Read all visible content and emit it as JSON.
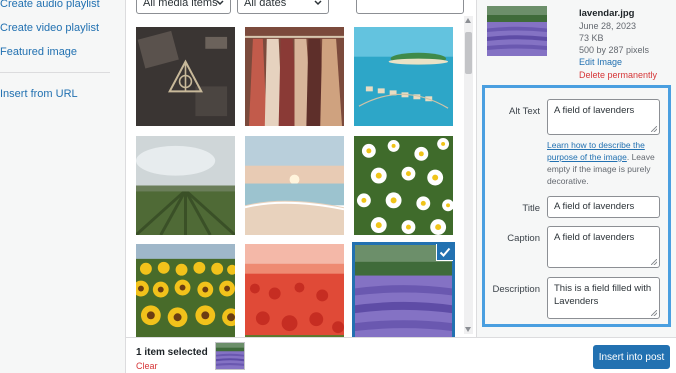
{
  "left_menu": {
    "items": [
      "Create audio playlist",
      "Create video playlist",
      "Featured image",
      "Insert from URL"
    ]
  },
  "toolbar": {
    "media_filter": "All media items",
    "date_filter": "All dates",
    "search_placeholder": ""
  },
  "grid": {
    "items": [
      {
        "icon": "dark-flatlay-photo",
        "selected": false
      },
      {
        "icon": "clothing-rack-photo",
        "selected": false
      },
      {
        "icon": "tropical-resort-photo",
        "selected": false
      },
      {
        "icon": "vineyard-photo",
        "selected": false
      },
      {
        "icon": "beach-sunset-photo",
        "selected": false
      },
      {
        "icon": "daisy-field-photo",
        "selected": false
      },
      {
        "icon": "sunflower-field-photo",
        "selected": false
      },
      {
        "icon": "poppy-field-photo",
        "selected": false
      },
      {
        "icon": "lavender-field-photo",
        "selected": true
      }
    ]
  },
  "attachment": {
    "filename": "lavendar.jpg",
    "date": "June 28, 2023",
    "size": "73 KB",
    "dimensions": "500 by 287 pixels",
    "edit_label": "Edit Image",
    "delete_label": "Delete permanently"
  },
  "fields": {
    "alt_text_label": "Alt Text",
    "alt_text_value": "A field of lavenders",
    "alt_help_link": "Learn how to describe the purpose of the image",
    "alt_help_rest": ". Leave empty if the image is purely decorative.",
    "title_label": "Title",
    "title_value": "A field of lavenders",
    "caption_label": "Caption",
    "caption_value": "A field of lavenders",
    "description_label": "Description",
    "description_value": "This is a field filled with Lavenders"
  },
  "footer": {
    "selected_count": "1 item selected",
    "clear_label": "Clear",
    "insert_label": "Insert into post"
  },
  "colors": {
    "accent": "#2271b1",
    "danger": "#d63638",
    "highlight": "#4a9fe0"
  }
}
